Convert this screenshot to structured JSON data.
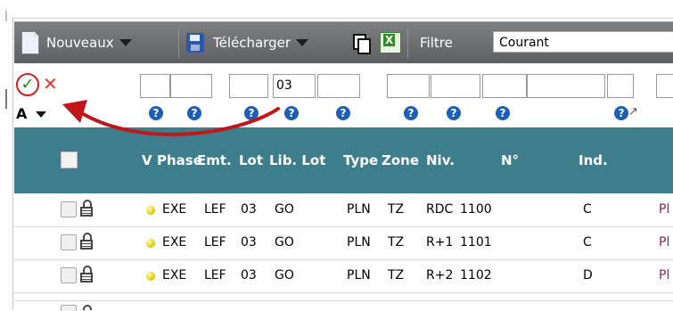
{
  "toolbar": {
    "new_label": "Nouveaux",
    "download_label": "Télécharger",
    "filter_label": "Filtre",
    "filter_value": "Courant",
    "icons": [
      "document-icon",
      "save-disk-icon",
      "copy-icon",
      "excel-icon"
    ]
  },
  "filter_row": {
    "lot_value": "03",
    "accent_check_color": "#1b8a1b",
    "accent_x_color": "#e03a2a"
  },
  "help_row": {
    "sort_label": "A",
    "help_glyph": "?"
  },
  "columns": [
    "V",
    "Phase",
    "Emt.",
    "Lot",
    "Lib. Lot",
    "Type",
    "Zone",
    "Niv.",
    "N°",
    "Ind."
  ],
  "rows": [
    {
      "phase": "EXE",
      "emt": "LEF",
      "lot": "03",
      "lib_lot": "GO",
      "type": "PLN",
      "zone": "TZ",
      "niv": "RDC",
      "num": "1100",
      "ind": "C",
      "extra": "Pl"
    },
    {
      "phase": "EXE",
      "emt": "LEF",
      "lot": "03",
      "lib_lot": "GO",
      "type": "PLN",
      "zone": "TZ",
      "niv": "R+1",
      "num": "1101",
      "ind": "C",
      "extra": "Pl"
    },
    {
      "phase": "EXE",
      "emt": "LEF",
      "lot": "03",
      "lib_lot": "GO",
      "type": "PLN",
      "zone": "TZ",
      "niv": "R+2",
      "num": "1102",
      "ind": "D",
      "extra": "Pl"
    }
  ],
  "colors": {
    "header_bg": "#3e7e8c",
    "toolbar_bg": "#6f7072",
    "arrow": "#c0161c",
    "extra_text": "#8b2252"
  }
}
